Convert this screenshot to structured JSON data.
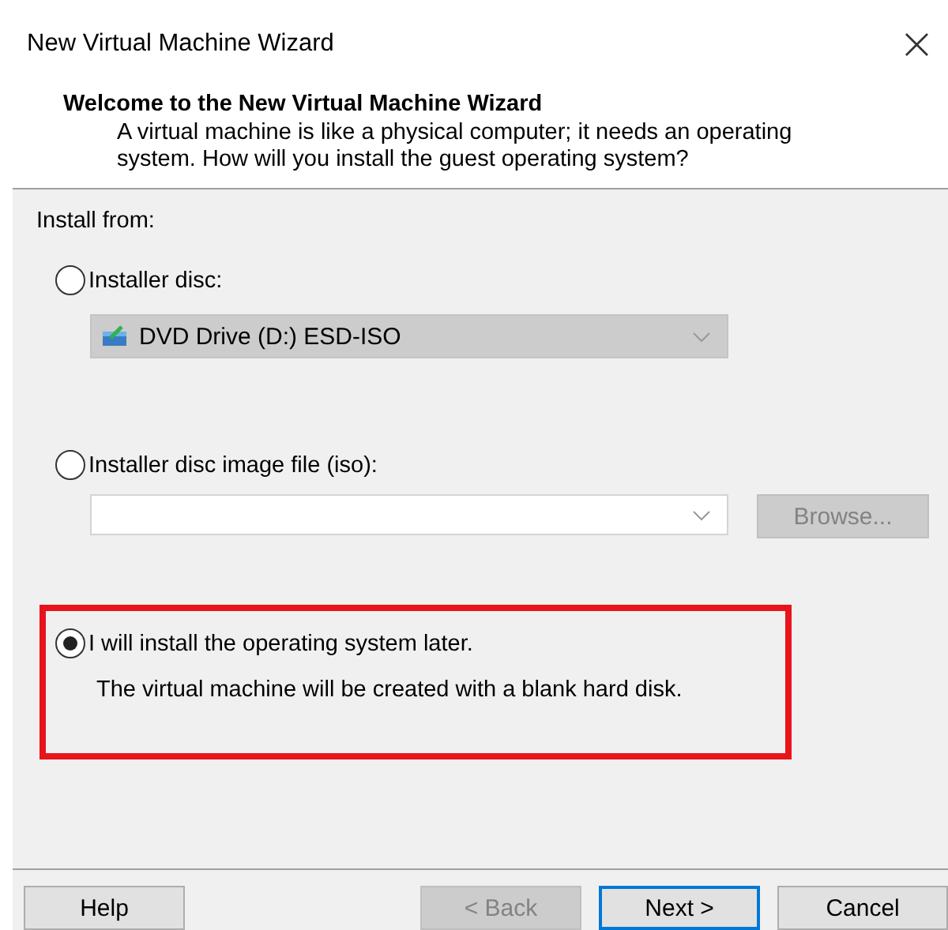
{
  "window": {
    "title": "New Virtual Machine Wizard",
    "close": "×"
  },
  "header": {
    "title": "Welcome to the New Virtual Machine Wizard",
    "description": "A virtual machine is like a physical computer; it needs an operating system. How will you install the guest operating system?"
  },
  "install_from": {
    "label": "Install from:",
    "options": [
      {
        "kind": "disc",
        "label": "Installer disc:",
        "selected": false,
        "highlighted": false,
        "combo": {
          "value": "DVD Drive (D:) ESD-ISO",
          "disabled": true
        }
      },
      {
        "kind": "iso",
        "label": "Installer disc image file (iso):",
        "selected": false,
        "highlighted": false,
        "combo": {
          "disabled": true
        },
        "browse": {
          "label": "Browse...",
          "disabled": true
        }
      },
      {
        "kind": "later",
        "label": "I will install the operating system later.",
        "selected": true,
        "highlighted": true,
        "description": "The virtual machine will be created with a blank hard disk."
      }
    ]
  },
  "buttons": [
    {
      "label": "Help",
      "disabled": false,
      "default": false
    },
    {
      "label": "< Back",
      "disabled": true,
      "default": false
    },
    {
      "label": "Next >",
      "disabled": false,
      "default": true
    },
    {
      "label": "Cancel",
      "disabled": false,
      "default": false
    }
  ]
}
